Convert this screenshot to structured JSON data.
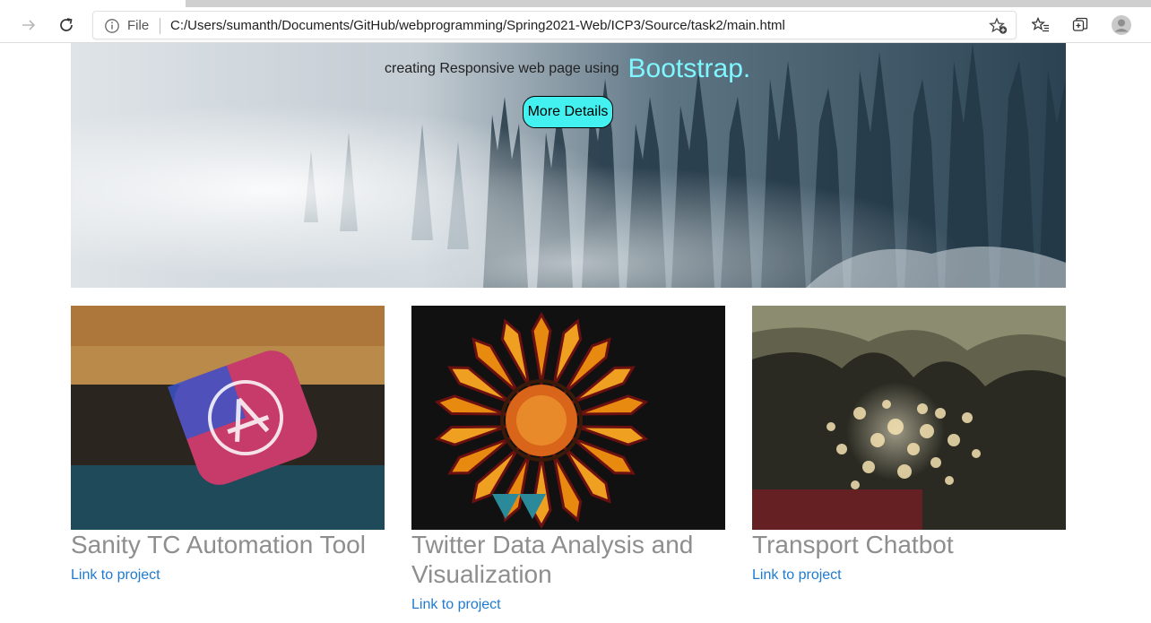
{
  "browser": {
    "address_prefix": "File",
    "url": "C:/Users/sumanth/Documents/GitHub/webprogramming/Spring2021-Web/ICP3/Source/task2/main.html",
    "icons": [
      "forward-icon",
      "refresh-icon",
      "info-icon",
      "add-favorite-icon",
      "favorites-icon",
      "collections-icon",
      "profile-icon"
    ]
  },
  "hero": {
    "lead_text": "creating Responsive web page using",
    "brand_text": "Bootstrap.",
    "button_label": "More Details",
    "colors": {
      "brand": "#7ff7ff",
      "button": "#44f1f1"
    }
  },
  "projects": [
    {
      "title": "Sanity TC Automation Tool",
      "link": "Link to project"
    },
    {
      "title": "Twitter Data Analysis and Visualization",
      "link": "Link to project"
    },
    {
      "title": "Transport Chatbot",
      "link": "Link to project"
    }
  ],
  "colors": {
    "title": "#8e8e8e",
    "link": "#1f7ad0"
  }
}
